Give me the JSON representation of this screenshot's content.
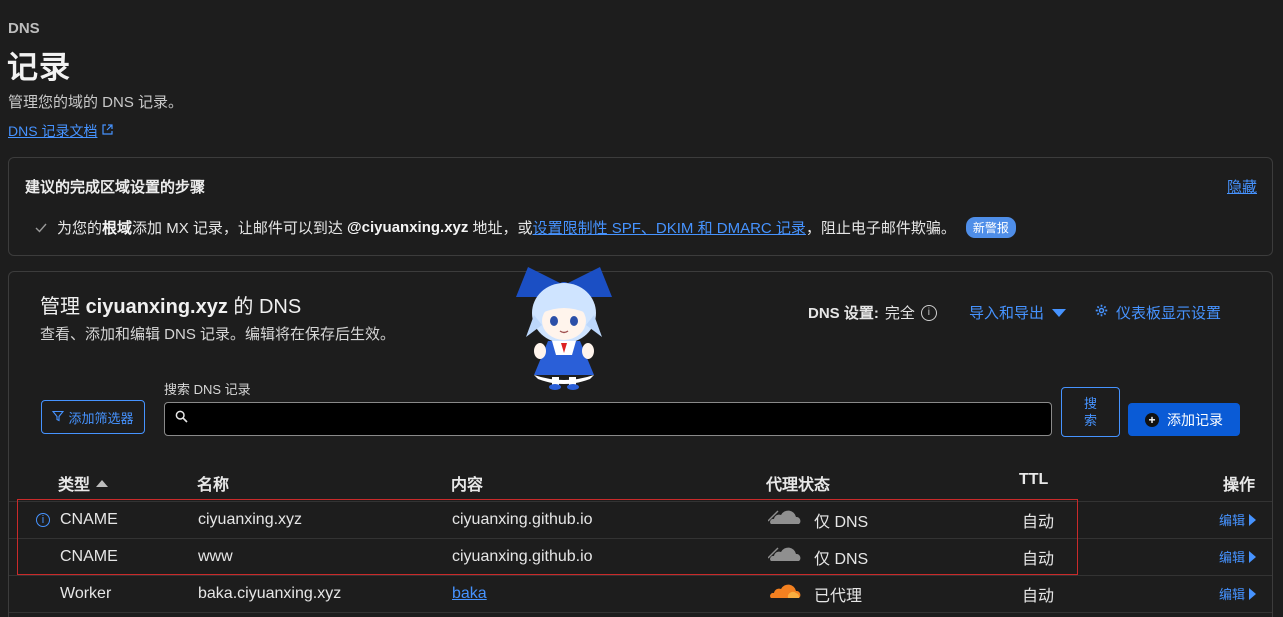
{
  "header": {
    "breadcrumb": "DNS",
    "title": "记录",
    "subtitle": "管理您的域的 DNS 记录。",
    "doc_link": "DNS 记录文档"
  },
  "recommend": {
    "title": "建议的完成区域设置的步骤",
    "hide_label": "隐藏",
    "step_prefix": "为您的",
    "step_bold": "根域",
    "step_mid": "添加 MX 记录，让邮件可以到达 ",
    "step_domain": "@ciyuanxing.xyz",
    "step_mid2": " 地址，或",
    "step_link": "设置限制性 SPF、DKIM 和 DMARC 记录",
    "step_suffix": "，阻止电子邮件欺骗。",
    "badge": "新警报"
  },
  "manage": {
    "title_prefix": "管理 ",
    "title_domain": "ciyuanxing.xyz",
    "title_suffix": " 的 DNS",
    "subtitle": "查看、添加和编辑 DNS 记录。编辑将在保存后生效。",
    "dns_setting_label": "DNS 设置:",
    "dns_setting_value": "完全",
    "import_export": "导入和导出",
    "dashboard_settings": "仪表板显示设置"
  },
  "search": {
    "filter_button": "添加筛选器",
    "label": "搜索 DNS 记录",
    "placeholder": "",
    "search_button_line1": "搜",
    "search_button_line2": "索",
    "add_button": "添加记录"
  },
  "table": {
    "headers": {
      "type": "类型",
      "name": "名称",
      "content": "内容",
      "proxy": "代理状态",
      "ttl": "TTL",
      "actions": "操作"
    },
    "rows": [
      {
        "type": "CNAME",
        "name": "ciyuanxing.xyz",
        "content": "ciyuanxing.github.io",
        "proxy": "仅 DNS",
        "ttl": "自动",
        "action": "编辑"
      },
      {
        "type": "CNAME",
        "name": "www",
        "content": "ciyuanxing.github.io",
        "proxy": "仅 DNS",
        "ttl": "自动",
        "action": "编辑"
      },
      {
        "type": "Worker",
        "name": "baka.ciyuanxing.xyz",
        "content": "baka",
        "proxy": "已代理",
        "ttl": "自动",
        "action": "编辑"
      }
    ]
  },
  "colors": {
    "accent": "#4693ff",
    "primary_button": "#0a5bd6",
    "cloud_dns_only": "#8f8f8f",
    "cloud_proxied": "#f38020",
    "highlight_box": "#c92a2a"
  }
}
